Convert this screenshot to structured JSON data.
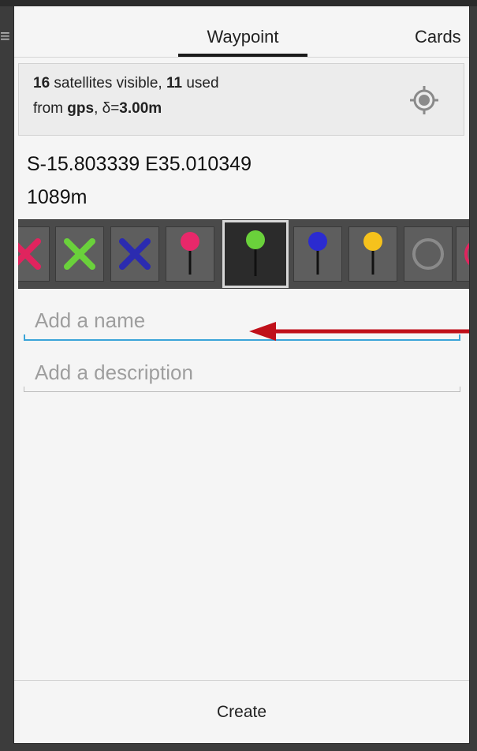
{
  "tabs": [
    {
      "label": "Waypoint"
    },
    {
      "label": "Cards"
    }
  ],
  "gps": {
    "satellites_visible": "16",
    "satellites_visible_text": " satellites visible, ",
    "satellites_used": "11",
    "satellites_used_text": " used",
    "from_text": "from ",
    "source": "gps",
    "delta_text": ", δ=",
    "accuracy": "3.00m",
    "icon": "gps-locate-icon"
  },
  "location": {
    "coordinates": "S-15.803339 E35.010349",
    "altitude": "1089m"
  },
  "markers": {
    "items": [
      {
        "icon": "cross-marker-icon",
        "color": "#e0245e"
      },
      {
        "icon": "cross-marker-icon",
        "color": "#6ad13b"
      },
      {
        "icon": "cross-marker-icon",
        "color": "#2b2bb0"
      },
      {
        "icon": "pin-marker-icon",
        "color": "#e8286a"
      },
      {
        "icon": "pin-marker-icon",
        "color": "#6ad13b",
        "selected": true
      },
      {
        "icon": "pin-marker-icon",
        "color": "#2b2bd0"
      },
      {
        "icon": "pin-marker-icon",
        "color": "#f6c21c"
      },
      {
        "icon": "circle-marker-icon",
        "color": "#8a8a8a"
      },
      {
        "icon": "circle-marker-icon",
        "color": "#e0245e"
      }
    ]
  },
  "form": {
    "name_placeholder": "Add a name",
    "name_value": "",
    "description_placeholder": "Add a description",
    "description_value": ""
  },
  "annotation": {
    "arrow_color": "#c0101a"
  },
  "footer": {
    "create_label": "Create"
  }
}
